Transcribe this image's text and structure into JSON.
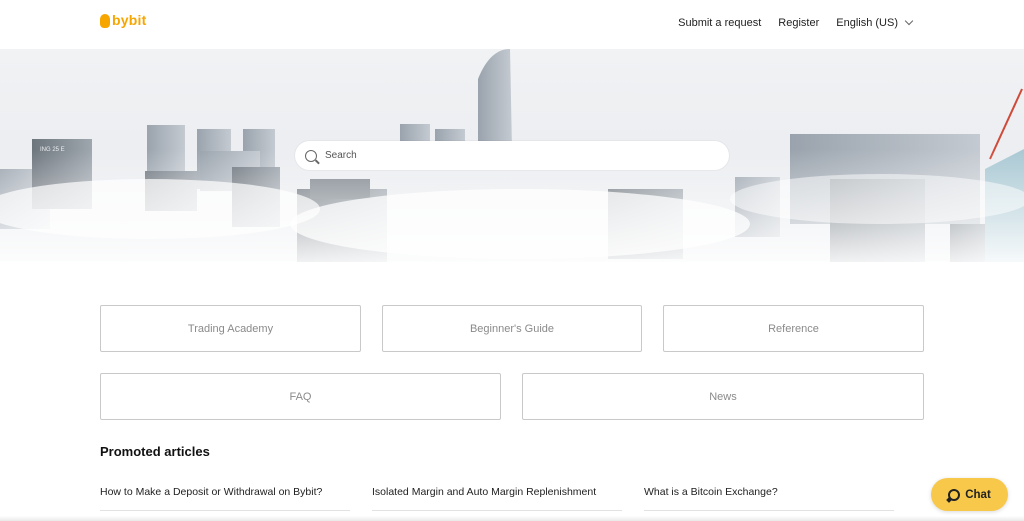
{
  "header": {
    "logo_text": "bybit",
    "nav": {
      "submit_request": "Submit a request",
      "register": "Register",
      "language": "English (US)"
    }
  },
  "hero": {
    "search_placeholder": "Search",
    "building_sign": "ING 25 E"
  },
  "categories": [
    {
      "label": "Trading Academy"
    },
    {
      "label": "Beginner's Guide"
    },
    {
      "label": "Reference"
    },
    {
      "label": "FAQ"
    },
    {
      "label": "News"
    }
  ],
  "promoted": {
    "title": "Promoted articles",
    "articles": [
      {
        "title": "How to Make a Deposit or Withdrawal on Bybit?"
      },
      {
        "title": "Isolated Margin and Auto Margin Replenishment"
      },
      {
        "title": "What is a Bitcoin Exchange?"
      }
    ]
  },
  "chat": {
    "label": "Chat"
  },
  "colors": {
    "brand": "#f7a600",
    "chat_bg": "#f7c84a",
    "tile_border": "#c9c9c9"
  }
}
